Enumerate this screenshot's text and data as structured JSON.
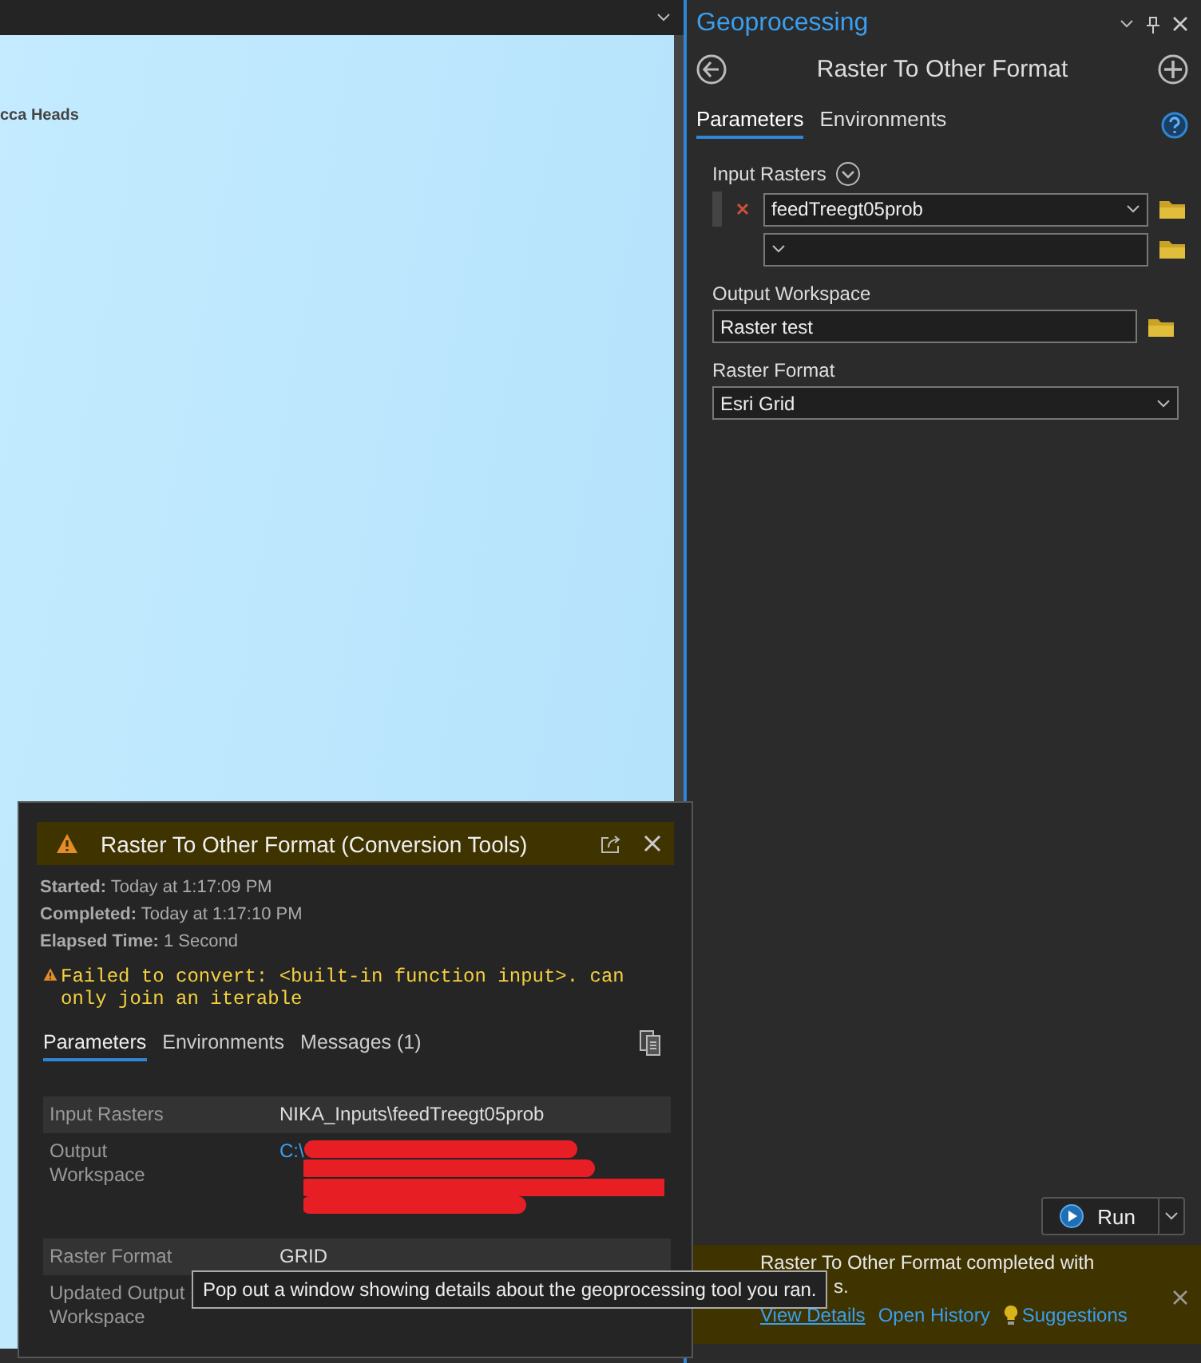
{
  "map_view": {
    "label": "cca Heads"
  },
  "geoprocessing": {
    "title": "Geoprocessing",
    "tool_title": "Raster To Other Format",
    "tabs": [
      {
        "label": "Parameters",
        "selected": true
      },
      {
        "label": "Environments",
        "selected": false
      }
    ],
    "parameters": [
      {
        "label": "Input Rasters",
        "kind": "multi",
        "rows": [
          {
            "value": "feedTreegt05prob",
            "removable": true
          },
          {
            "removable": false
          }
        ]
      },
      {
        "label": "Output Workspace",
        "kind": "text",
        "value": "Raster test"
      },
      {
        "label": "Raster Format",
        "kind": "dropdown",
        "value": "Esri Grid"
      }
    ],
    "run_button": "Run",
    "notification": {
      "lines": [
        "Raster To Other Format completed with",
        "s."
      ],
      "links": [
        {
          "label": "View Details",
          "kind": "link",
          "hovered": true
        },
        {
          "label": "Open History",
          "kind": "link",
          "hovered": false
        },
        {
          "label": "Suggestions",
          "kind": "tip",
          "hovered": false
        }
      ]
    }
  },
  "popup": {
    "title": "Raster To Other Format (Conversion Tools)",
    "meta": [
      {
        "label": "Started:",
        "value": "Today at 1:17:09 PM"
      },
      {
        "label": "Completed:",
        "value": "Today at 1:17:10 PM"
      },
      {
        "label": "Elapsed Time:",
        "value": "1 Second"
      }
    ],
    "warning": "Failed to convert: <built-in function input>. can only join an iterable",
    "tabs": [
      {
        "label": "Parameters",
        "selected": true
      },
      {
        "label": "Environments",
        "selected": false
      },
      {
        "label": "Messages (1)",
        "selected": false
      }
    ],
    "rows": [
      {
        "name": "Input Rasters",
        "value": "NIKA_Inputs\\feedTreegt05prob",
        "redacted": false
      },
      {
        "name": "Output Workspace",
        "value": "C:\\",
        "redacted": true
      },
      {
        "name": "Raster Format",
        "value": "GRID",
        "redacted": false
      },
      {
        "name": "Updated Output Workspace",
        "redacted": false
      }
    ]
  },
  "tooltip": "Pop out a window showing details about the geoprocessing tool you ran."
}
